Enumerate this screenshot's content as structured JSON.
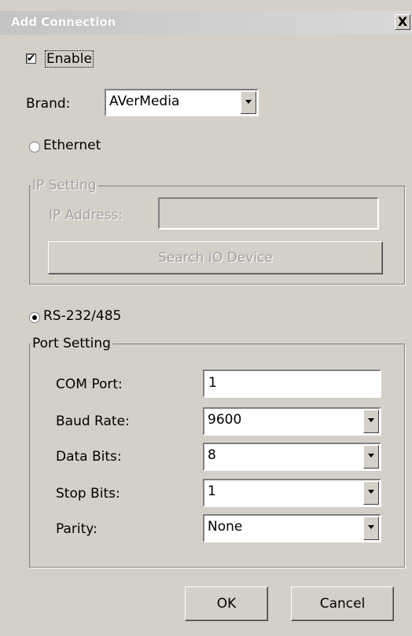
{
  "window": {
    "title": "Add Connection",
    "close_glyph": "X"
  },
  "enable": {
    "label": "Enable",
    "checked": true
  },
  "brand": {
    "label": "Brand:",
    "value": "AVerMedia"
  },
  "ethernet": {
    "label": "Ethernet",
    "selected": false,
    "ip_group": {
      "legend": "IP Setting",
      "ip_label": "IP Address:",
      "ip_value": "",
      "search_button": "Search IO Device"
    }
  },
  "serial": {
    "label": "RS-232/485",
    "selected": true,
    "port_group": {
      "legend": "Port Setting",
      "com_port": {
        "label": "COM Port:",
        "value": "1"
      },
      "baud_rate": {
        "label": "Baud Rate:",
        "value": "9600"
      },
      "data_bits": {
        "label": "Data Bits:",
        "value": "8"
      },
      "stop_bits": {
        "label": "Stop Bits:",
        "value": "1"
      },
      "parity": {
        "label": "Parity:",
        "value": "None"
      }
    }
  },
  "buttons": {
    "ok": "OK",
    "cancel": "Cancel"
  }
}
